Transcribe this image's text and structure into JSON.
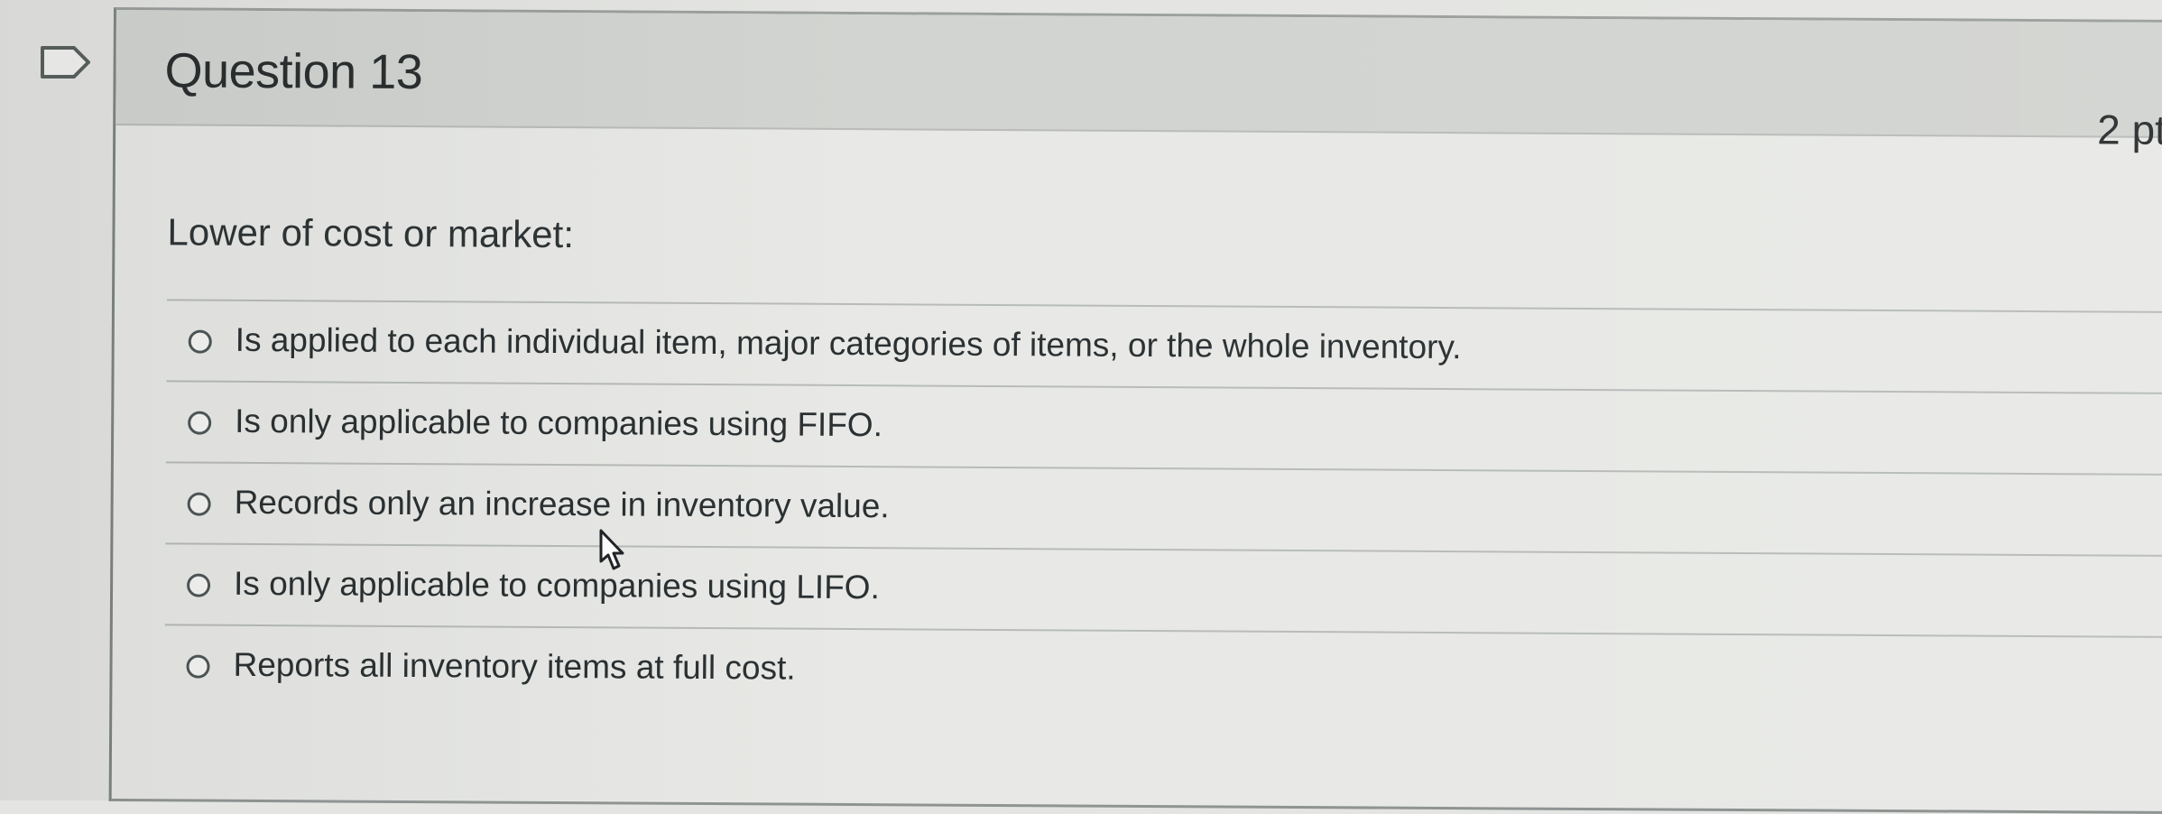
{
  "question": {
    "title": "Question 13",
    "points": "2 pt",
    "prompt": "Lower of cost or market:"
  },
  "answers": [
    {
      "label": "Is applied to each individual item, major categories of items, or the whole inventory."
    },
    {
      "label": "Is only applicable to companies using FIFO."
    },
    {
      "label": "Records only an increase in inventory value."
    },
    {
      "label": "Is only applicable to companies using LIFO."
    },
    {
      "label": "Reports all inventory items at full cost."
    }
  ],
  "icons": {
    "bookmark": "bookmark-flag-icon",
    "radio": "radio-unselected-icon",
    "cursor": "mouse-pointer-icon"
  },
  "colors": {
    "header_background": "#d2d4d1",
    "card_background": "#e8e9e6",
    "text": "#2b3133"
  }
}
